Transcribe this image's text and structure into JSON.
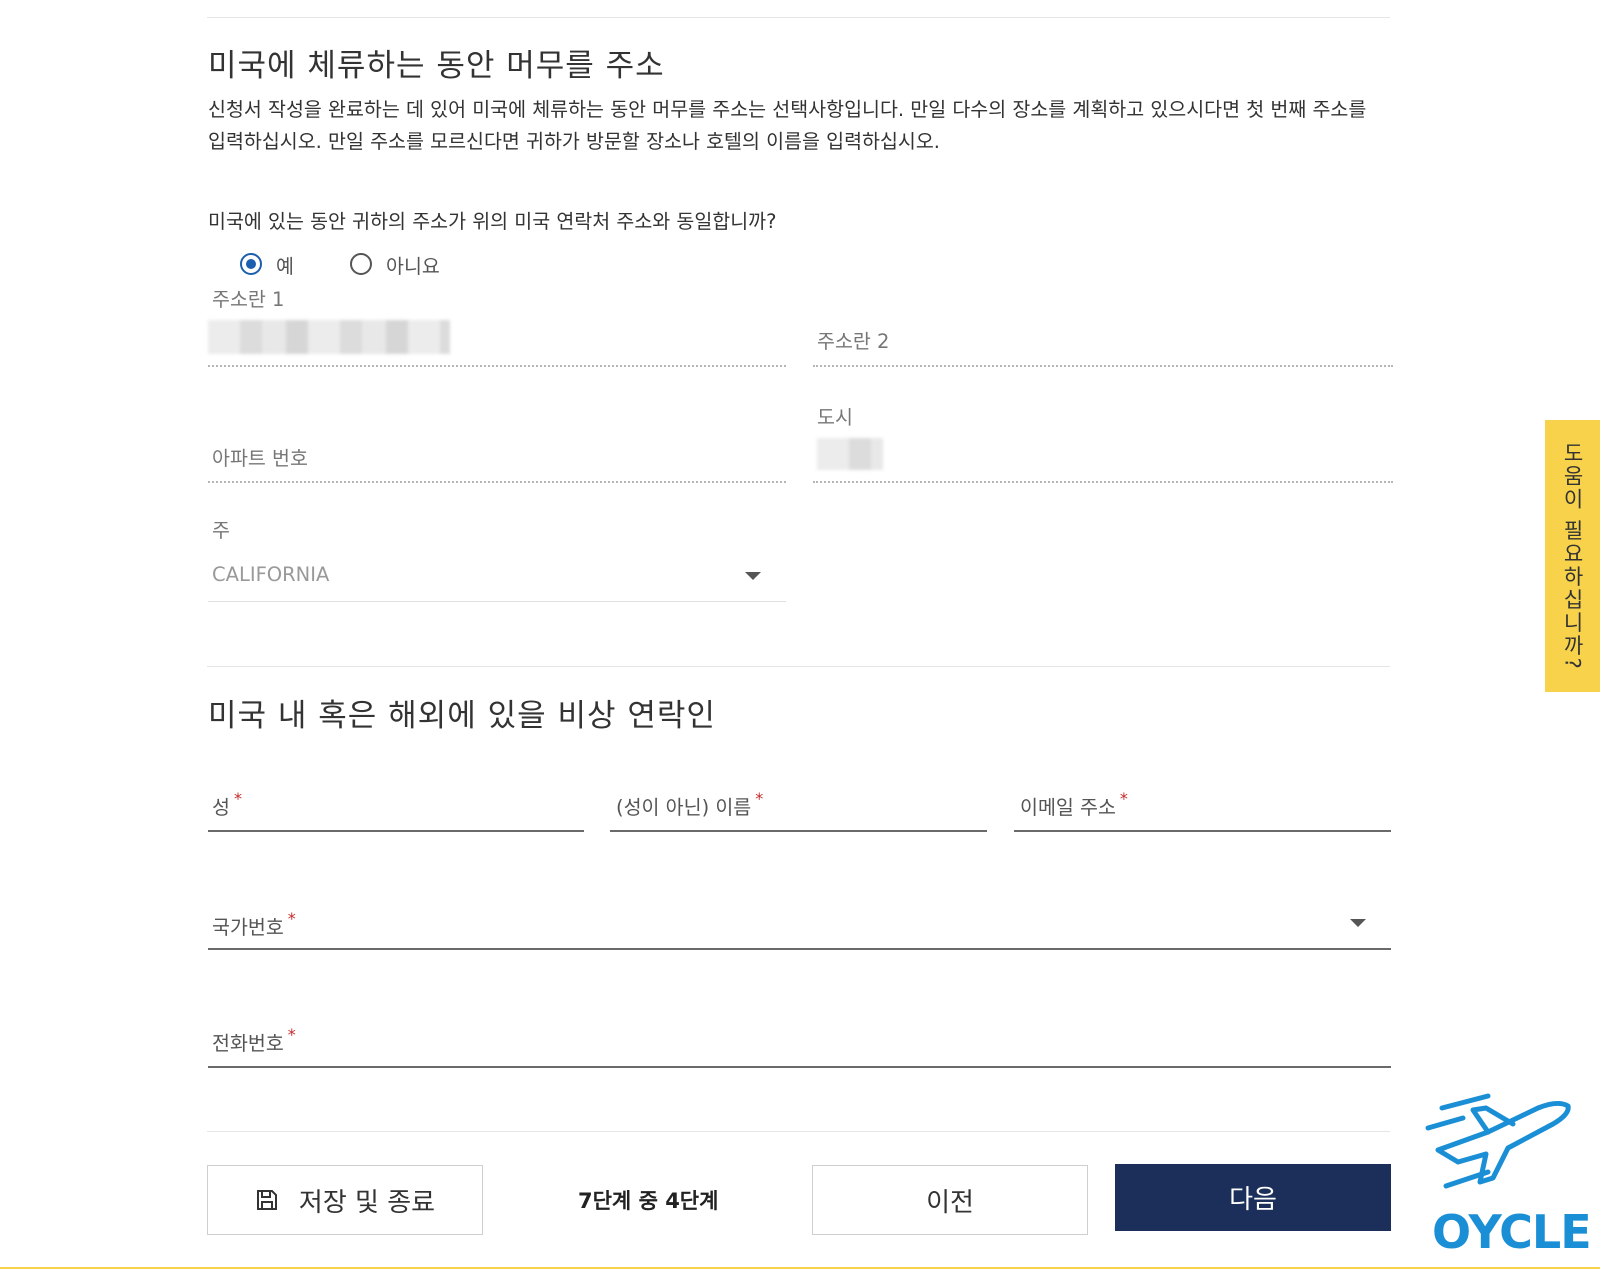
{
  "section1": {
    "title": "미국에 체류하는 동안 머무를 주소",
    "description": "신청서 작성을 완료하는 데 있어 미국에 체류하는 동안 머무를 주소는 선택사항입니다. 만일 다수의 장소를 계획하고 있으시다면 첫 번째 주소를 입력하십시오. 만일 주소를 모르신다면 귀하가 방문할 장소나 호텔의 이름을 입력하십시오.",
    "question": "미국에 있는 동안 귀하의 주소가 위의 미국 연락처 주소와 동일합니까?",
    "radio_yes": "예",
    "radio_no": "아니요",
    "selected": "예",
    "address1_label": "주소란 1",
    "address2_label": "주소란 2",
    "apt_label": "아파트 번호",
    "city_label": "도시",
    "state_label": "주",
    "state_value": "CALIFORNIA"
  },
  "section2": {
    "title": "미국 내 혹은 해외에 있을 비상 연락인",
    "last_name_label": "성",
    "first_name_label": "(성이 아닌) 이름",
    "email_label": "이메일 주소",
    "country_code_label": "국가번호",
    "phone_label": "전화번호",
    "required_mark": "*"
  },
  "footer": {
    "save_exit_label": "저장 및 종료",
    "step_text": "7단계 중 4단계",
    "prev_label": "이전",
    "next_label": "다음"
  },
  "help_tab": "도움이 필요하십니까?",
  "logo_text": "OYCLE",
  "colors": {
    "primary": "#1b2f5a",
    "radio": "#1b5fae",
    "help": "#f7d24a",
    "required": "#c62828",
    "logo": "#1a8fd6"
  }
}
